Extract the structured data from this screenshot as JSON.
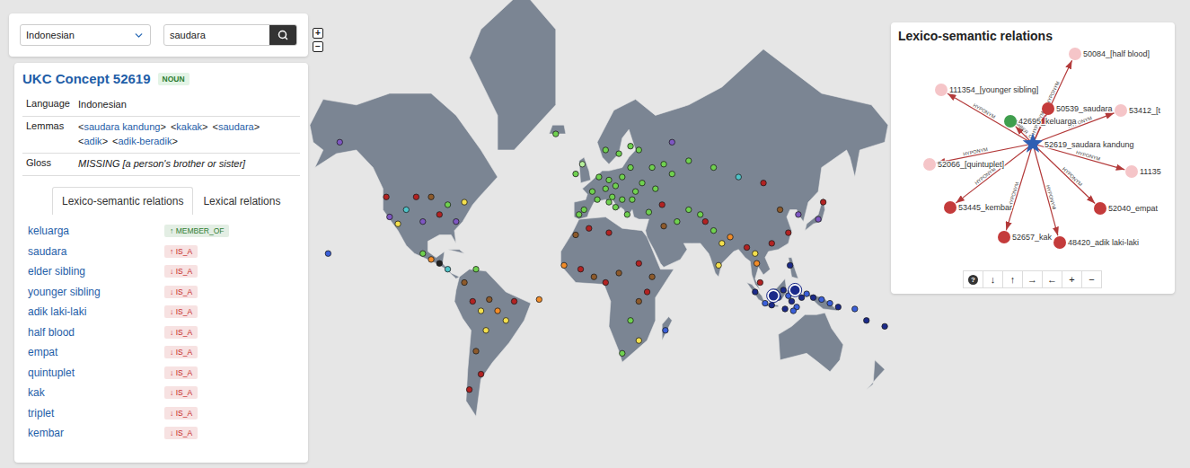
{
  "search": {
    "language": "Indonesian",
    "query": "saudara"
  },
  "concept": {
    "title": "UKC Concept 52619",
    "pos": "NOUN",
    "lemma_open": "<",
    "lemma_close": ">",
    "fields": [
      {
        "label": "Language",
        "kind": "text",
        "value": "Indonesian"
      },
      {
        "label": "Lemmas",
        "kind": "lemmas",
        "lemmas": [
          "saudara kandung",
          "kakak",
          "saudara",
          "adik",
          "adik-beradik"
        ]
      },
      {
        "label": "Gloss",
        "kind": "gloss",
        "value": "MISSING [a person's brother or sister]"
      }
    ]
  },
  "tabs": [
    {
      "label": "Lexico-semantic relations",
      "selected": true
    },
    {
      "label": "Lexical relations",
      "selected": false
    }
  ],
  "relations": [
    {
      "name": "keluarga",
      "arrow": "↑",
      "type": "MEMBER_OF",
      "color": "#2e7d32"
    },
    {
      "name": "saudara",
      "arrow": "↑",
      "type": "IS_A",
      "color": "#c62828"
    },
    {
      "name": "elder sibling",
      "arrow": "↓",
      "type": "IS_A",
      "color": "#c62828"
    },
    {
      "name": "younger sibling",
      "arrow": "↓",
      "type": "IS_A",
      "color": "#c62828"
    },
    {
      "name": "adik laki-laki",
      "arrow": "↓",
      "type": "IS_A",
      "color": "#c62828"
    },
    {
      "name": "half blood",
      "arrow": "↓",
      "type": "IS_A",
      "color": "#c62828"
    },
    {
      "name": "empat",
      "arrow": "↓",
      "type": "IS_A",
      "color": "#c62828"
    },
    {
      "name": "quintuplet",
      "arrow": "↓",
      "type": "IS_A",
      "color": "#c62828"
    },
    {
      "name": "kak",
      "arrow": "↓",
      "type": "IS_A",
      "color": "#c62828"
    },
    {
      "name": "triplet",
      "arrow": "↓",
      "type": "IS_A",
      "color": "#c62828"
    },
    {
      "name": "kembar",
      "arrow": "↓",
      "type": "IS_A",
      "color": "#c62828"
    }
  ],
  "map": {
    "zoom_buttons": [
      "+",
      "−"
    ],
    "points": [
      {
        "lon": -3,
        "lat": 40,
        "color": "#6fd14f",
        "highlighted": false
      },
      {
        "lon": 2,
        "lat": 47,
        "color": "#6fd14f",
        "highlighted": false
      },
      {
        "lon": 5,
        "lat": 44,
        "color": "#6fd14f",
        "highlighted": false
      },
      {
        "lon": 10,
        "lat": 48,
        "color": "#6fd14f",
        "highlighted": false
      },
      {
        "lon": 12,
        "lat": 51,
        "color": "#6fd14f",
        "highlighted": false
      },
      {
        "lon": 16,
        "lat": 49,
        "color": "#6fd14f",
        "highlighted": false
      },
      {
        "lon": 20,
        "lat": 52,
        "color": "#6fd14f",
        "highlighted": false
      },
      {
        "lon": 25,
        "lat": 55,
        "color": "#6fd14f",
        "highlighted": false
      },
      {
        "lon": 18,
        "lat": 59,
        "color": "#6fd14f",
        "highlighted": false
      },
      {
        "lon": 25,
        "lat": 61,
        "color": "#6fd14f",
        "highlighted": false
      },
      {
        "lon": 10,
        "lat": 60,
        "color": "#6fd14f",
        "highlighted": false
      },
      {
        "lon": 6,
        "lat": 52,
        "color": "#6fd14f",
        "highlighted": false
      },
      {
        "lon": -8,
        "lat": 53,
        "color": "#6fd14f",
        "highlighted": false
      },
      {
        "lon": -4,
        "lat": 56,
        "color": "#b6f09c",
        "highlighted": false
      },
      {
        "lon": 14,
        "lat": 45,
        "color": "#6fd14f",
        "highlighted": false
      },
      {
        "lon": 20,
        "lat": 44,
        "color": "#6fd14f",
        "highlighted": false
      },
      {
        "lon": 26,
        "lat": 44,
        "color": "#6fd14f",
        "highlighted": false
      },
      {
        "lon": 28,
        "lat": 47,
        "color": "#6fd14f",
        "highlighted": false
      },
      {
        "lon": 32,
        "lat": 50,
        "color": "#6fd14f",
        "highlighted": false
      },
      {
        "lon": 38,
        "lat": 55,
        "color": "#6fd14f",
        "highlighted": false
      },
      {
        "lon": 45,
        "lat": 56,
        "color": "#6fd14f",
        "highlighted": false
      },
      {
        "lon": 50,
        "lat": 53,
        "color": "#6fd14f",
        "highlighted": false
      },
      {
        "lon": 23,
        "lat": 38,
        "color": "#6fd14f",
        "highlighted": false
      },
      {
        "lon": 16,
        "lat": 41,
        "color": "#6fd14f",
        "highlighted": false
      },
      {
        "lon": 12,
        "lat": 43,
        "color": "#6fd14f",
        "highlighted": false
      },
      {
        "lon": -6,
        "lat": 38,
        "color": "#6fd14f",
        "highlighted": false
      },
      {
        "lon": 30,
        "lat": 60,
        "color": "#6fd14f",
        "highlighted": false
      },
      {
        "lon": 40,
        "lat": 48,
        "color": "#6fd14f",
        "highlighted": false
      },
      {
        "lon": 44,
        "lat": 42,
        "color": "#b22222",
        "highlighted": false
      },
      {
        "lon": 36,
        "lat": 39,
        "color": "#6fd14f",
        "highlighted": false
      },
      {
        "lon": -20,
        "lat": 64,
        "color": "#6fd14f",
        "highlighted": false
      },
      {
        "lon": 60,
        "lat": 57,
        "color": "#6fd14f",
        "highlighted": false
      },
      {
        "lon": 50,
        "lat": 62,
        "color": "#7e57c2",
        "highlighted": false
      },
      {
        "lon": 75,
        "lat": 55,
        "color": "#6fd14f",
        "highlighted": false
      },
      {
        "lon": 90,
        "lat": 52,
        "color": "#4fc3c8",
        "highlighted": false
      },
      {
        "lon": 105,
        "lat": 50,
        "color": "#b22222",
        "highlighted": false
      },
      {
        "lon": 115,
        "lat": 40,
        "color": "#8d5a2b",
        "highlighted": false
      },
      {
        "lon": 120,
        "lat": 30,
        "color": "#b22222",
        "highlighted": false
      },
      {
        "lon": 110,
        "lat": 25,
        "color": "#b22222",
        "highlighted": false
      },
      {
        "lon": 126,
        "lat": 38,
        "color": "#7e57c2",
        "highlighted": false
      },
      {
        "lon": 138,
        "lat": 36,
        "color": "#7e57c2",
        "highlighted": false
      },
      {
        "lon": 141,
        "lat": 43,
        "color": "#b22222",
        "highlighted": false
      },
      {
        "lon": 100,
        "lat": 20,
        "color": "#f4e04d",
        "highlighted": false
      },
      {
        "lon": 95,
        "lat": 23,
        "color": "#b22222",
        "highlighted": false
      },
      {
        "lon": 80,
        "lat": 25,
        "color": "#f4e04d",
        "highlighted": false
      },
      {
        "lon": 75,
        "lat": 31,
        "color": "#6fd14f",
        "highlighted": false
      },
      {
        "lon": 70,
        "lat": 35,
        "color": "#b22222",
        "highlighted": false
      },
      {
        "lon": 85,
        "lat": 28,
        "color": "#f28c28",
        "highlighted": false
      },
      {
        "lon": 78,
        "lat": 14,
        "color": "#f4e04d",
        "highlighted": false
      },
      {
        "lon": 67,
        "lat": 38,
        "color": "#6fd14f",
        "highlighted": false
      },
      {
        "lon": 60,
        "lat": 40,
        "color": "#6fd14f",
        "highlighted": false
      },
      {
        "lon": 53,
        "lat": 35,
        "color": "#6fd14f",
        "highlighted": false
      },
      {
        "lon": 45,
        "lat": 33,
        "color": "#8d5a2b",
        "highlighted": false
      },
      {
        "lon": 101,
        "lat": 15,
        "color": "#f28c28",
        "highlighted": false
      },
      {
        "lon": 103,
        "lat": 5,
        "color": "#b22222",
        "highlighted": false
      },
      {
        "lon": 121,
        "lat": 14,
        "color": "#1b2a8a",
        "highlighted": false
      },
      {
        "lon": 100,
        "lat": 0,
        "color": "#1b2a8a",
        "highlighted": false
      },
      {
        "lon": 106,
        "lat": -6,
        "color": "#3a5fd9",
        "highlighted": false
      },
      {
        "lon": 110,
        "lat": -7,
        "color": "#1b2a8a",
        "highlighted": false
      },
      {
        "lon": 114,
        "lat": -3,
        "color": "#3a5fd9",
        "highlighted": false
      },
      {
        "lon": 117,
        "lat": 1,
        "color": "#1b2a8a",
        "highlighted": false
      },
      {
        "lon": 120,
        "lat": -2,
        "color": "#3a5fd9",
        "highlighted": false
      },
      {
        "lon": 122,
        "lat": -5,
        "color": "#1b2a8a",
        "highlighted": false
      },
      {
        "lon": 125,
        "lat": -8,
        "color": "#3a5fd9",
        "highlighted": false
      },
      {
        "lon": 128,
        "lat": -3,
        "color": "#1b2a8a",
        "highlighted": false
      },
      {
        "lon": 131,
        "lat": -1,
        "color": "#3a5fd9",
        "highlighted": false
      },
      {
        "lon": 135,
        "lat": -3,
        "color": "#1b2a8a",
        "highlighted": false
      },
      {
        "lon": 140,
        "lat": -4,
        "color": "#3a5fd9",
        "highlighted": false
      },
      {
        "lon": 118,
        "lat": -9,
        "color": "#1b2a8a",
        "highlighted": false
      },
      {
        "lon": 123,
        "lat": -10,
        "color": "#3a5fd9",
        "highlighted": false
      },
      {
        "lon": 111,
        "lat": -2,
        "color": "#1b2a8a",
        "highlighted": true
      },
      {
        "lon": 124,
        "lat": 1,
        "color": "#1b2a8a",
        "highlighted": true
      },
      {
        "lon": 145,
        "lat": -6,
        "color": "#3a5fd9",
        "highlighted": false
      },
      {
        "lon": 150,
        "lat": -8,
        "color": "#1b2a8a",
        "highlighted": false
      },
      {
        "lon": 160,
        "lat": -9,
        "color": "#3a5fd9",
        "highlighted": false
      },
      {
        "lon": 167,
        "lat": -15,
        "color": "#1b2a8a",
        "highlighted": false
      },
      {
        "lon": 178,
        "lat": -18,
        "color": "#1b2a8a",
        "highlighted": false
      },
      {
        "lon": -15,
        "lat": 14,
        "color": "#f28c28",
        "highlighted": false
      },
      {
        "lon": -5,
        "lat": 12,
        "color": "#b22222",
        "highlighted": false
      },
      {
        "lon": 3,
        "lat": 8,
        "color": "#8d5a2b",
        "highlighted": false
      },
      {
        "lon": 10,
        "lat": 5,
        "color": "#b22222",
        "highlighted": false
      },
      {
        "lon": 18,
        "lat": 10,
        "color": "#8d5a2b",
        "highlighted": false
      },
      {
        "lon": 30,
        "lat": 15,
        "color": "#b22222",
        "highlighted": false
      },
      {
        "lon": 38,
        "lat": 8,
        "color": "#8d5a2b",
        "highlighted": false
      },
      {
        "lon": 35,
        "lat": 0,
        "color": "#b22222",
        "highlighted": false
      },
      {
        "lon": 30,
        "lat": -5,
        "color": "#8d5a2b",
        "highlighted": false
      },
      {
        "lon": 25,
        "lat": -15,
        "color": "#6fd14f",
        "highlighted": false
      },
      {
        "lon": 30,
        "lat": -25,
        "color": "#f4e04d",
        "highlighted": false
      },
      {
        "lon": 20,
        "lat": -31,
        "color": "#6fd14f",
        "highlighted": false
      },
      {
        "lon": 46,
        "lat": -20,
        "color": "#3a5fd9",
        "highlighted": false
      },
      {
        "lon": 12,
        "lat": 30,
        "color": "#b22222",
        "highlighted": false
      },
      {
        "lon": 0,
        "lat": 32,
        "color": "#b22222",
        "highlighted": false
      },
      {
        "lon": -8,
        "lat": 29,
        "color": "#8d5a2b",
        "highlighted": false
      },
      {
        "lon": -150,
        "lat": 62,
        "color": "#7e57c2",
        "highlighted": false
      },
      {
        "lon": -122,
        "lat": 45,
        "color": "#b22222",
        "highlighted": false
      },
      {
        "lon": -120,
        "lat": 37,
        "color": "#7e57c2",
        "highlighted": false
      },
      {
        "lon": -115,
        "lat": 34,
        "color": "#f4e04d",
        "highlighted": false
      },
      {
        "lon": -110,
        "lat": 40,
        "color": "#4fc3c8",
        "highlighted": false
      },
      {
        "lon": -104,
        "lat": 45,
        "color": "#b22222",
        "highlighted": false
      },
      {
        "lon": -100,
        "lat": 35,
        "color": "#7e57c2",
        "highlighted": false
      },
      {
        "lon": -95,
        "lat": 45,
        "color": "#8d5a2b",
        "highlighted": false
      },
      {
        "lon": -90,
        "lat": 38,
        "color": "#b22222",
        "highlighted": false
      },
      {
        "lon": -85,
        "lat": 42,
        "color": "#6fd14f",
        "highlighted": false
      },
      {
        "lon": -80,
        "lat": 35,
        "color": "#7e57c2",
        "highlighted": false
      },
      {
        "lon": -75,
        "lat": 43,
        "color": "#f4e04d",
        "highlighted": false
      },
      {
        "lon": -100,
        "lat": 20,
        "color": "#6fd14f",
        "highlighted": false
      },
      {
        "lon": -95,
        "lat": 17,
        "color": "#f28c28",
        "highlighted": false
      },
      {
        "lon": -90,
        "lat": 15,
        "color": "#222222",
        "highlighted": false
      },
      {
        "lon": -85,
        "lat": 12,
        "color": "#4fc3c8",
        "highlighted": false
      },
      {
        "lon": -75,
        "lat": 5,
        "color": "#8d5a2b",
        "highlighted": false
      },
      {
        "lon": -70,
        "lat": -5,
        "color": "#b22222",
        "highlighted": false
      },
      {
        "lon": -65,
        "lat": -10,
        "color": "#f4e04d",
        "highlighted": false
      },
      {
        "lon": -60,
        "lat": -4,
        "color": "#8d5a2b",
        "highlighted": false
      },
      {
        "lon": -55,
        "lat": -10,
        "color": "#f28c28",
        "highlighted": false
      },
      {
        "lon": -50,
        "lat": -15,
        "color": "#f4e04d",
        "highlighted": false
      },
      {
        "lon": -45,
        "lat": -5,
        "color": "#b22222",
        "highlighted": false
      },
      {
        "lon": -62,
        "lat": -20,
        "color": "#f4e04d",
        "highlighted": false
      },
      {
        "lon": -68,
        "lat": -30,
        "color": "#8d5a2b",
        "highlighted": false
      },
      {
        "lon": -65,
        "lat": -40,
        "color": "#b22222",
        "highlighted": false
      },
      {
        "lon": -72,
        "lat": -46,
        "color": "#b22222",
        "highlighted": false
      },
      {
        "lon": -30,
        "lat": -4,
        "color": "#f28c28",
        "highlighted": false
      },
      {
        "lon": -157,
        "lat": 20,
        "color": "#3a5fd9",
        "highlighted": false
      },
      {
        "lon": -68,
        "lat": 12,
        "color": "#6fd14f",
        "highlighted": false
      }
    ]
  },
  "graph": {
    "title": "Lexico-semantic relations",
    "center": {
      "label": "52619_saudara kandung",
      "color": "#2f5fb3"
    },
    "nodes": [
      {
        "label": "50084_[half blood]",
        "color": "#f5c5c8",
        "relation": "HYPONYM"
      },
      {
        "label": "111354_[younger sibling]",
        "color": "#f5c5c8",
        "relation": "HYPONYM"
      },
      {
        "label": "50539_saudara",
        "color": "#c43b3b",
        "relation": "HYPONYM"
      },
      {
        "label": "42695_keluarga",
        "color": "#3f9e4d",
        "relation": "MEMBER_OF"
      },
      {
        "label": "53412_[t",
        "color": "#f5c5c8",
        "relation": "HYPONYM"
      },
      {
        "label": "11135",
        "color": "#f5c5c8",
        "relation": "HYPONYM"
      },
      {
        "label": "52066_[quintuplet]",
        "color": "#f5c5c8",
        "relation": "HYPONYM"
      },
      {
        "label": "53445_kembar",
        "color": "#c43b3b",
        "relation": "HYPONYM"
      },
      {
        "label": "52040_empat",
        "color": "#c43b3b",
        "relation": "HYPONYM"
      },
      {
        "label": "52657_kak",
        "color": "#c43b3b",
        "relation": "HYPONYM"
      },
      {
        "label": "48420_adik laki-laki",
        "color": "#c43b3b",
        "relation": "HYPONYM"
      }
    ],
    "toolbar": [
      {
        "label": "?",
        "kind": "help"
      },
      {
        "label": "↓",
        "kind": "arrow"
      },
      {
        "label": "↑",
        "kind": "arrow"
      },
      {
        "label": "→",
        "kind": "arrow"
      },
      {
        "label": "←",
        "kind": "arrow"
      },
      {
        "label": "+",
        "kind": "arrow"
      },
      {
        "label": "−",
        "kind": "arrow"
      }
    ]
  }
}
